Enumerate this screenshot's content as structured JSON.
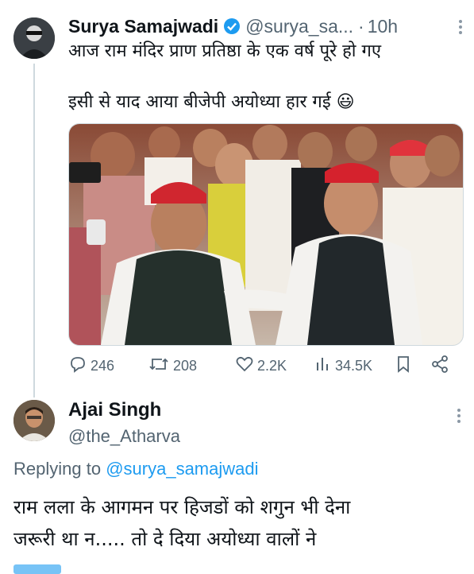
{
  "tweet": {
    "author_name": "Surya Samajwadi",
    "author_handle": "@surya_sa...",
    "separator": "·",
    "time": "10h",
    "text_line1": "आज राम मंदिर प्राण प्रतिष्ठा के एक वर्ष पूरे हो गए",
    "text_line2": "इसी से याद आया बीजेपी अयोध्या हार गई 😃",
    "stats": {
      "replies": "246",
      "retweets": "208",
      "likes": "2.2K",
      "views": "34.5K"
    }
  },
  "reply": {
    "author_name": "Ajai Singh",
    "author_handle": "@the_Atharva",
    "replying_prefix": "Replying to",
    "replying_to": "@surya_samajwadi",
    "text_line1": "राम लला के आगमन पर हिजडों को शगुन भी देना",
    "text_line2": "जरूरी था न..... तो दे दिया अयोध्या वालों ने"
  },
  "colors": {
    "verified": "#1d9bf0",
    "link": "#1d9bf0",
    "secondary": "#536471"
  },
  "icons": [
    "verified-icon",
    "more-icon",
    "reply-icon",
    "retweet-icon",
    "like-icon",
    "views-icon",
    "bookmark-icon",
    "share-icon"
  ]
}
